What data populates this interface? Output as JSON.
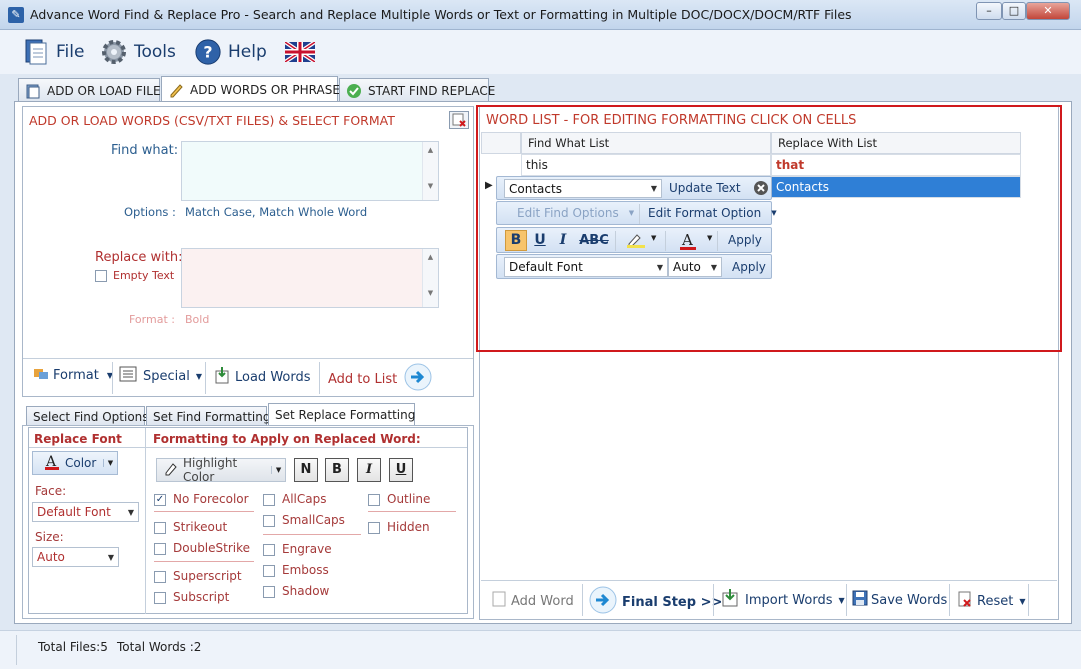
{
  "window": {
    "title": "Advance Word Find & Replace Pro - Search and Replace Multiple Words or Text  or Formatting in Multiple DOC/DOCX/DOCM/RTF Files",
    "btn_min": "–",
    "btn_max": "□",
    "btn_close": "✕"
  },
  "menu": {
    "file": "File",
    "tools": "Tools",
    "help": "Help"
  },
  "tabs": {
    "add_files": "ADD OR LOAD FILES",
    "add_words": "ADD WORDS OR PHRASES",
    "start": "START FIND REPLACE"
  },
  "left_panel": {
    "title": "ADD OR LOAD WORDS (CSV/TXT FILES) & SELECT FORMAT",
    "find_label": "Find what:",
    "options_label": "Options :",
    "options_value": "Match Case, Match Whole Word",
    "replace_label": "Replace with:",
    "empty_text": "Empty Text",
    "format_label": "Format :",
    "format_value": "Bold",
    "toolbar": {
      "format": "Format",
      "special": "Special",
      "load_words": "Load Words",
      "add_to_list": "Add to List"
    }
  },
  "sub_tabs": {
    "find_options": "Select Find Options",
    "find_formatting": "Set Find Formatting",
    "replace_formatting": "Set Replace Formatting"
  },
  "replace_font": {
    "title": "Replace Font",
    "color_btn": "Color",
    "face_label": "Face:",
    "face_value": "Default Font",
    "size_label": "Size:",
    "size_value": "Auto"
  },
  "formatting": {
    "title": "Formatting to Apply on Replaced Word:",
    "highlight": "Highlight Color",
    "btn_n": "N",
    "btn_b": "B",
    "btn_i": "I",
    "btn_u": "U",
    "no_forecolor": "No Forecolor",
    "allcaps": "AllCaps",
    "outline": "Outline",
    "strikeout": "Strikeout",
    "smallcaps": "SmallCaps",
    "hidden": "Hidden",
    "doublestrike": "DoubleStrike",
    "engrave": "Engrave",
    "emboss": "Emboss",
    "superscript": "Superscript",
    "shadow": "Shadow",
    "subscript": "Subscript"
  },
  "word_list": {
    "title": "WORD LIST - FOR EDITING FORMATTING CLICK ON CELLS",
    "col_find": "Find What List",
    "col_replace": "Replace With List",
    "rows": [
      {
        "find": "this",
        "replace": "that"
      },
      {
        "find": "Contacts",
        "replace": "Contacts"
      }
    ],
    "popup": {
      "update_text": "Update Text",
      "edit_find": "Edit Find Options",
      "edit_format": "Edit Format Option",
      "bold": "B",
      "underline": "U",
      "italic": "I",
      "strike": "ABC",
      "fontcolor": "A",
      "apply": "Apply",
      "font": "Default Font",
      "size": "Auto",
      "apply2": "Apply"
    },
    "toolbar": {
      "add_word": "Add Word",
      "final_step": "Final Step >>",
      "import_words": "Import Words",
      "save_words": "Save Words",
      "reset": "Reset"
    }
  },
  "status": {
    "total_files": "Total Files:5",
    "total_words": "Total Words :2"
  }
}
